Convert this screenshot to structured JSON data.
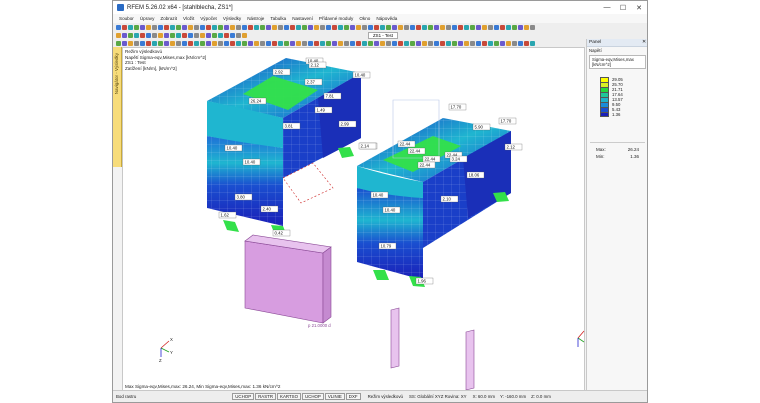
{
  "window": {
    "title": "RFEM 5.26.02 x64 - [stahlblecha, ZS1*]",
    "controls": [
      "—",
      "☐",
      "✕"
    ]
  },
  "menu": [
    "Soubor",
    "Úpravy",
    "Zobrazit",
    "Vložit",
    "Výpočet",
    "Výsledky",
    "Nástroje",
    "Tabulka",
    "Nastavení",
    "Přídavné moduly",
    "Okno",
    "Nápověda"
  ],
  "toolbar": {
    "load_case": "ZS1 - Test"
  },
  "navigator_tab": "Navigátor - Výsledky",
  "viewport": {
    "info": [
      "Režim výsledkovú",
      "Napětí Sigma-eqv,Mises,max [kN/cm^2]",
      "ZS1 : Test",
      "Zatížení [kN/m], [kN/m^2]"
    ],
    "footer": "Max Sigma-eqv,Mises,max: 26.24, Min Sigma-eqv,Mises,max: 1.36 kN/cm^2",
    "value_labels": [
      "10.40",
      "2.92",
      "2.37",
      "10.40",
      "7.81",
      "26.24",
      "1.49",
      "3.81",
      "2.99",
      "10.40",
      "10.40",
      "5.40",
      "3.80",
      "2.40",
      "1.62",
      "0.42",
      "2.14",
      "2.12",
      "17.70",
      "5.90",
      "17.70",
      "22.44",
      "22.44",
      "22.44",
      "22.44",
      "22.44",
      "3.24",
      "2.12",
      "18.06",
      "10.40",
      "2.10",
      "10.40",
      "10.79",
      "1.96"
    ],
    "load_label": "p 21.0000 d",
    "axes": {
      "x": "X",
      "y": "Y",
      "z": "Z"
    }
  },
  "panel": {
    "title": "Panel",
    "close": "✕",
    "group": "Napětí",
    "quantity": "Sigma-eqv,Mises,max [kN/cm^2]",
    "legend": [
      {
        "value": "29.05",
        "color": "#ffff00"
      },
      {
        "value": "25.70",
        "color": "#d9f026"
      },
      {
        "value": "21.71",
        "color": "#26d93d"
      },
      {
        "value": "17.64",
        "color": "#1fc79a"
      },
      {
        "value": "13.57",
        "color": "#1fb3c9"
      },
      {
        "value": "9.50",
        "color": "#1a8cd9"
      },
      {
        "value": "5.43",
        "color": "#1a4fd0"
      },
      {
        "value": "1.36",
        "color": "#1a1fb8"
      }
    ],
    "max_label": "Max:",
    "max_value": "26.24",
    "min_label": "Min:",
    "min_value": "1.36"
  },
  "status": {
    "left": "Bod rastru",
    "buttons": [
      "UCHOP",
      "RASTR",
      "KARTSO",
      "UCHOP",
      "VLINIE",
      "DXF"
    ],
    "mode": "Režim výsledkovú",
    "coords": "SS: Globální XYZ   Rovina: XY",
    "x": "X: 60.0 mm",
    "y": "Y: -160.0 mm",
    "z": "Z: 0.0 mm"
  }
}
